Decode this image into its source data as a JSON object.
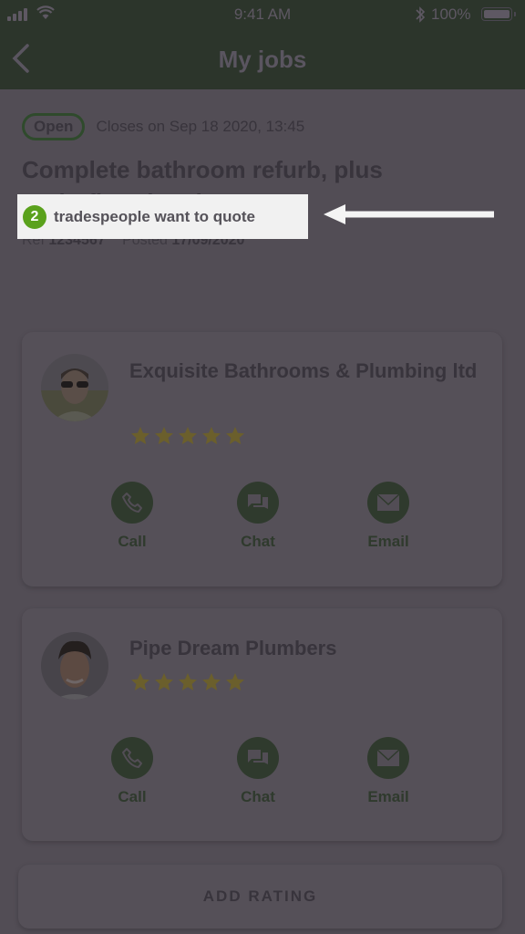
{
  "status_bar": {
    "time": "9:41 AM",
    "battery": "100%",
    "icons": [
      "signal-icon",
      "wifi-icon",
      "bluetooth-icon",
      "battery-icon"
    ]
  },
  "nav": {
    "title": "My jobs",
    "back_icon": "chevron-left-icon"
  },
  "job": {
    "status": "Open",
    "closes": "Closes on Sep 18 2020, 13:45",
    "title": "Complete bathroom refurb, plus underfloor heating",
    "ref_label": "Ref",
    "ref_value": "1234567",
    "posted_label": "Posted",
    "posted_value": "17/09/2020"
  },
  "quotes_banner": {
    "count": "2",
    "text": "tradespeople want to quote",
    "annotation": "arrow-left-icon"
  },
  "tradespeople": [
    {
      "name": "Exquisite Bathrooms & Plumbing ltd",
      "rating": 5,
      "rating_max": 5,
      "actions": [
        {
          "label": "Call",
          "icon": "phone-icon"
        },
        {
          "label": "Chat",
          "icon": "chat-icon"
        },
        {
          "label": "Email",
          "icon": "email-icon"
        }
      ]
    },
    {
      "name": "Pipe Dream Plumbers",
      "rating": 5,
      "rating_max": 5,
      "actions": [
        {
          "label": "Call",
          "icon": "phone-icon"
        },
        {
          "label": "Chat",
          "icon": "chat-icon"
        },
        {
          "label": "Email",
          "icon": "email-icon"
        }
      ]
    }
  ],
  "add_rating_label": "ADD RATING",
  "colors": {
    "header": "#2c352b",
    "overlay_bg": "#524d55",
    "accent_green": "#5aa11c",
    "star": "#6b5f2c",
    "action_green": "#2f3a2d"
  }
}
